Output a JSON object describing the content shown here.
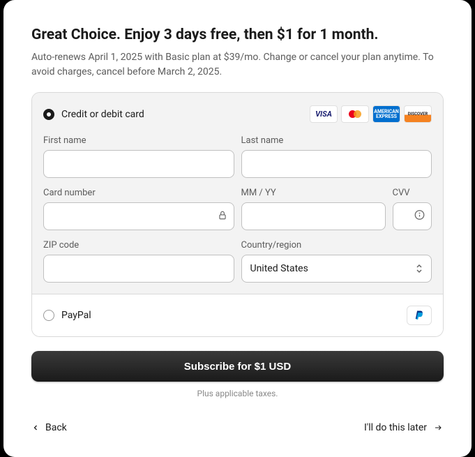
{
  "heading": "Great Choice. Enjoy 3 days free, then $1 for 1 month.",
  "subheading": "Auto-renews April 1, 2025 with Basic plan at $39/mo. Change or cancel your plan anytime. To avoid charges, cancel before March 2, 2025.",
  "payment": {
    "card_option_label": "Credit or debit card",
    "paypal_option_label": "PayPal",
    "fields": {
      "first_name_label": "First name",
      "last_name_label": "Last name",
      "card_number_label": "Card number",
      "expiry_label": "MM / YY",
      "cvv_label": "CVV",
      "zip_label": "ZIP code",
      "country_label": "Country/region",
      "country_value": "United States"
    }
  },
  "cta": {
    "subscribe_label": "Subscribe for $1 USD",
    "tax_note": "Plus applicable taxes."
  },
  "footer": {
    "back_label": "Back",
    "later_label": "I'll do this later"
  }
}
